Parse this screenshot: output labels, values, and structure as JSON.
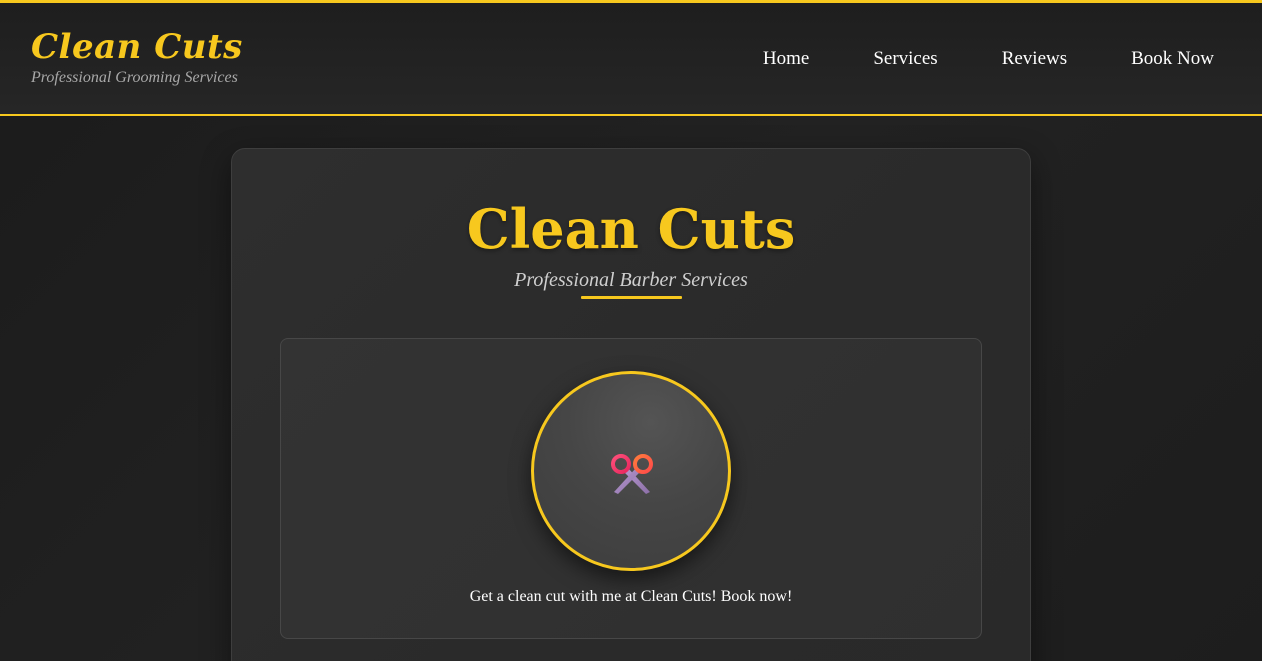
{
  "header": {
    "brand_name": "Clean Cuts",
    "brand_tagline": "Professional Grooming Services",
    "nav": [
      {
        "label": "Home"
      },
      {
        "label": "Services"
      },
      {
        "label": "Reviews"
      },
      {
        "label": "Book Now"
      }
    ]
  },
  "hero": {
    "title": "Clean Cuts",
    "subtitle": "Professional Barber Services"
  },
  "promo": {
    "icon": "scissors-icon",
    "text": "Get a clean cut with me at Clean Cuts! Book now!"
  },
  "colors": {
    "accent": "#f7c81e",
    "background": "#1f1f1f",
    "card": "#2e2e2e",
    "text": "#ffffff",
    "muted": "#a8a8a8"
  }
}
